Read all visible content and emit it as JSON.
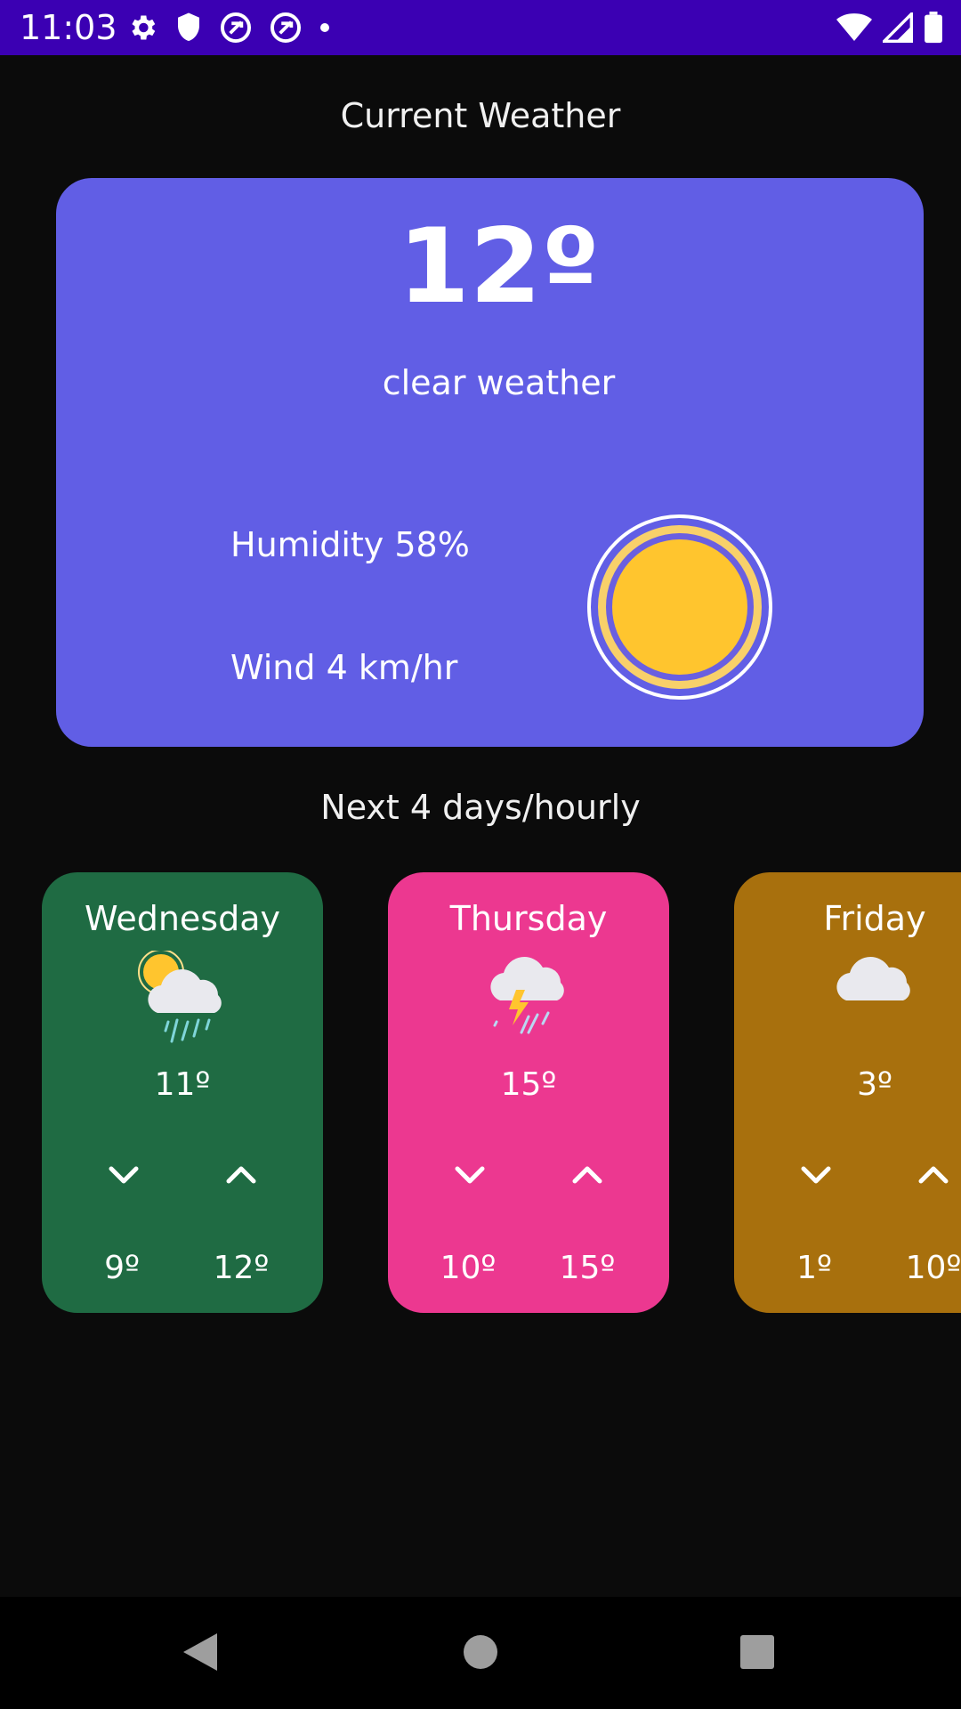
{
  "status_bar": {
    "time": "11:03",
    "left_icons": [
      "gear-icon",
      "shield-icon",
      "at-sign-icon",
      "at-sign-icon",
      "dot-icon"
    ],
    "right_icons": [
      "wifi-icon",
      "signal-icon",
      "battery-icon"
    ]
  },
  "current": {
    "title": "Current Weather",
    "temperature": "12º",
    "condition": "clear weather",
    "humidity": "Humidity 58%",
    "wind": "Wind 4 km/hr",
    "icon": "sun-icon",
    "card_color": "#615ee5"
  },
  "forecast": {
    "title": "Next 4 days/hourly",
    "days": [
      {
        "name": "Wednesday",
        "temp": "11º",
        "low": "9º",
        "high": "12º",
        "icon": "sun-cloud-rain-icon",
        "color": "#1f6b43"
      },
      {
        "name": "Thursday",
        "temp": "15º",
        "low": "10º",
        "high": "15º",
        "icon": "thunderstorm-icon",
        "color": "#ec3890"
      },
      {
        "name": "Friday",
        "temp": "3º",
        "low": "1º",
        "high": "10º",
        "icon": "cloud-icon",
        "color": "#a8700d"
      }
    ]
  },
  "nav_bar": {
    "icons": [
      "back-triangle-icon",
      "home-circle-icon",
      "recents-square-icon"
    ]
  }
}
